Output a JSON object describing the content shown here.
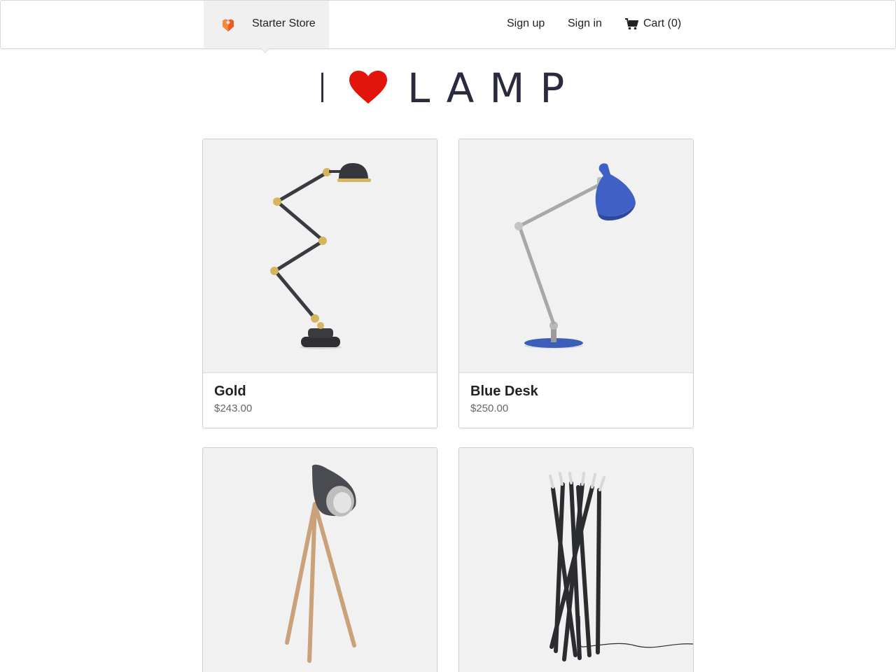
{
  "header": {
    "brand_name": "Starter Store",
    "nav": {
      "signup": "Sign up",
      "signin": "Sign in",
      "cart": "Cart (0)"
    }
  },
  "hero": {
    "left": "I",
    "right": "LAMP",
    "heart_color": "#e2140c"
  },
  "products": [
    {
      "name": "Gold",
      "price": "$243.00"
    },
    {
      "name": "Blue Desk",
      "price": "$250.00"
    },
    {
      "name": "",
      "price": ""
    },
    {
      "name": "",
      "price": ""
    }
  ],
  "colors": {
    "accent": "#e2140c",
    "brand_logo": "#f05a22",
    "tile_bg": "#f1f1f1"
  }
}
